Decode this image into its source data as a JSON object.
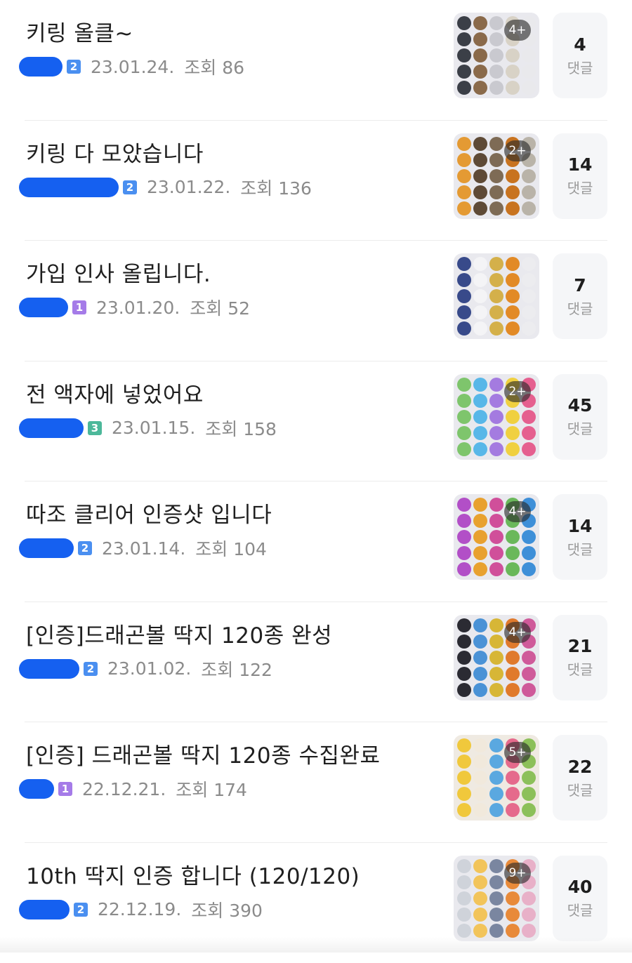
{
  "posts": [
    {
      "title": "키링 올클~",
      "level": "2",
      "level_color": "#4a8ff0",
      "date": "23.01.24.",
      "views": "조회 86",
      "thumb_badge": "4+",
      "thumb_colors": [
        "#3b3f47",
        "#c9c9cf",
        "#e9e9ec",
        "#8a6a4a",
        "#d8d2c6"
      ],
      "comment_count": "4",
      "comment_label": "댓글"
    },
    {
      "title": "키링 다 모았습니다",
      "level": "2",
      "level_color": "#4a8ff0",
      "date": "23.01.22.",
      "views": "조회 136",
      "thumb_badge": "2+",
      "thumb_colors": [
        "#c8731f",
        "#e49a33",
        "#7e6b55",
        "#b9b3a8",
        "#5e4a36"
      ],
      "comment_count": "14",
      "comment_label": "댓글"
    },
    {
      "title": "가입 인사 올립니다.",
      "level": "1",
      "level_color": "#a57be8",
      "date": "23.01.20.",
      "views": "조회 52",
      "thumb_badge": "",
      "thumb_colors": [
        "#f4f4f6",
        "#e28a26",
        "#384a8a",
        "#d4b04a",
        "#ececef"
      ],
      "comment_count": "7",
      "comment_label": "댓글"
    },
    {
      "title": "전 액자에 넣었어요",
      "level": "3",
      "level_color": "#4cb89a",
      "date": "23.01.15.",
      "views": "조회 158",
      "thumb_badge": "2+",
      "thumb_colors": [
        "#e55f8f",
        "#58b7e8",
        "#f0d040",
        "#7ec56c",
        "#a47be0"
      ],
      "comment_count": "45",
      "comment_label": "댓글"
    },
    {
      "title": "따조 클리어 인증샷 입니다",
      "level": "2",
      "level_color": "#4a8ff0",
      "date": "23.01.14.",
      "views": "조회 104",
      "thumb_badge": "4+",
      "thumb_colors": [
        "#d04f9a",
        "#3e8fd8",
        "#e8a12f",
        "#6ab85a",
        "#b24fc7"
      ],
      "comment_count": "14",
      "comment_label": "댓글"
    },
    {
      "title": "[인증]드래곤볼 딱지 120종 완성",
      "level": "2",
      "level_color": "#4a8ff0",
      "date": "23.01.02.",
      "views": "조회 122",
      "thumb_badge": "4+",
      "thumb_colors": [
        "#2b2b33",
        "#d7b636",
        "#cf5a9a",
        "#4a92d6",
        "#e07a2c"
      ],
      "comment_count": "21",
      "comment_label": "댓글"
    },
    {
      "title": "[인증] 드래곤볼 딱지 120종 수집완료",
      "level": "1",
      "level_color": "#a57be8",
      "date": "22.12.21.",
      "views": "조회 174",
      "thumb_badge": "5+",
      "thumb_colors": [
        "#e56a8c",
        "#f0c83c",
        "#5aa8e0",
        "#8cc05a",
        "#f1e9dc"
      ],
      "comment_count": "22",
      "comment_label": "댓글"
    },
    {
      "title": "10th 딱지 인증 합니다 (120/120)",
      "level": "2",
      "level_color": "#4a8ff0",
      "date": "22.12.19.",
      "views": "조회 390",
      "thumb_badge": "9+",
      "thumb_colors": [
        "#f2c45a",
        "#e88a3a",
        "#cfd3da",
        "#7a86a0",
        "#e8b0c8"
      ],
      "comment_count": "40",
      "comment_label": "댓글"
    }
  ]
}
